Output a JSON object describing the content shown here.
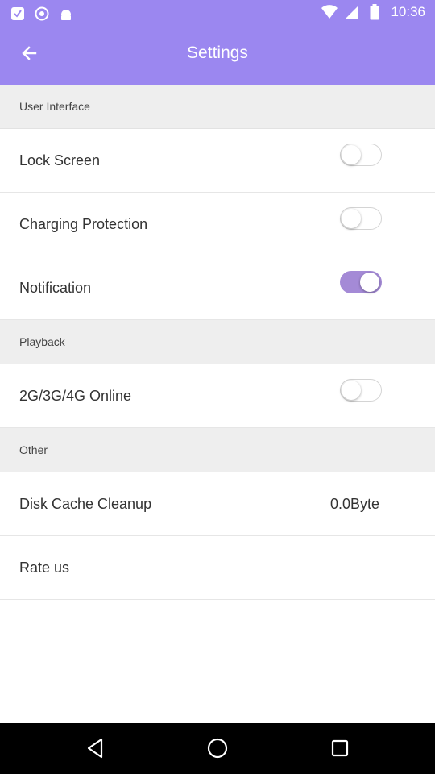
{
  "status_bar": {
    "time": "10:36",
    "left_icons": [
      "app-notification-icon",
      "circle-notification-icon",
      "android-icon"
    ],
    "right_icons": [
      "wifi-icon",
      "signal-icon",
      "battery-icon"
    ]
  },
  "header": {
    "title": "Settings",
    "back_icon": "arrow-left-icon"
  },
  "sections": {
    "user_interface": {
      "title": "User Interface",
      "items": {
        "lock_screen": {
          "label": "Lock Screen",
          "enabled": false
        },
        "charging_protection": {
          "label": "Charging Protection",
          "enabled": false
        },
        "notification": {
          "label": "Notification",
          "enabled": true
        }
      }
    },
    "playback": {
      "title": "Playback",
      "items": {
        "online": {
          "label": "2G/3G/4G Online",
          "enabled": false
        }
      }
    },
    "other": {
      "title": "Other",
      "items": {
        "disk_cache": {
          "label": "Disk Cache Cleanup",
          "value": "0.0Byte"
        },
        "rate_us": {
          "label": "Rate us"
        }
      }
    }
  },
  "nav_bar": {
    "buttons": [
      "back-triangle-icon",
      "home-circle-icon",
      "recents-square-icon"
    ]
  },
  "colors": {
    "primary": "#9b87f0",
    "switch_on": "#a48ad6",
    "section_bg": "#eeeeee"
  }
}
